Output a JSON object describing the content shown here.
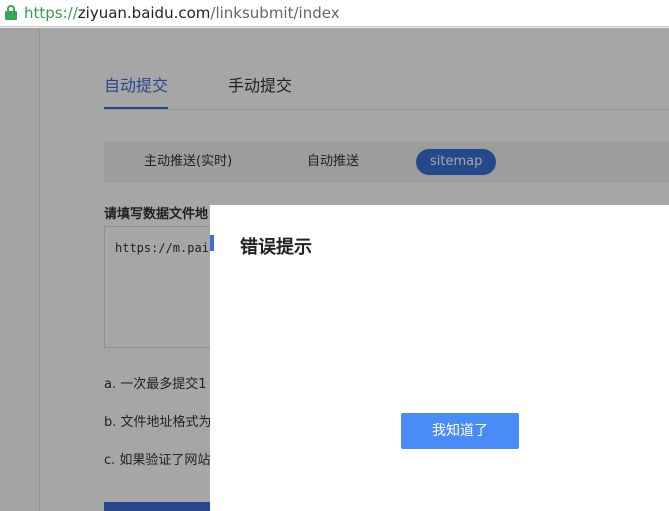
{
  "browser": {
    "url_scheme": "https://",
    "url_host": "ziyuan.baidu.com",
    "url_path": "/linksubmit/index"
  },
  "page": {
    "tabs": [
      {
        "label": "自动提交",
        "active": true
      },
      {
        "label": "手动提交",
        "active": false
      }
    ],
    "subtabs": [
      {
        "label": "主动推送(实时)",
        "active": false
      },
      {
        "label": "自动推送",
        "active": false
      },
      {
        "label": "sitemap",
        "active": true
      }
    ],
    "form_label": "请填写数据文件地",
    "textarea_value": "https://m.paiz",
    "notes": [
      "a. 一次最多提交1",
      "b. 文件地址格式为",
      "c. 如果验证了网站"
    ]
  },
  "modal": {
    "title": "错误提示",
    "confirm_label": "我知道了"
  },
  "colors": {
    "accent": "#3a6fd8",
    "button": "#4a8cf7",
    "secure": "#3aa757"
  }
}
